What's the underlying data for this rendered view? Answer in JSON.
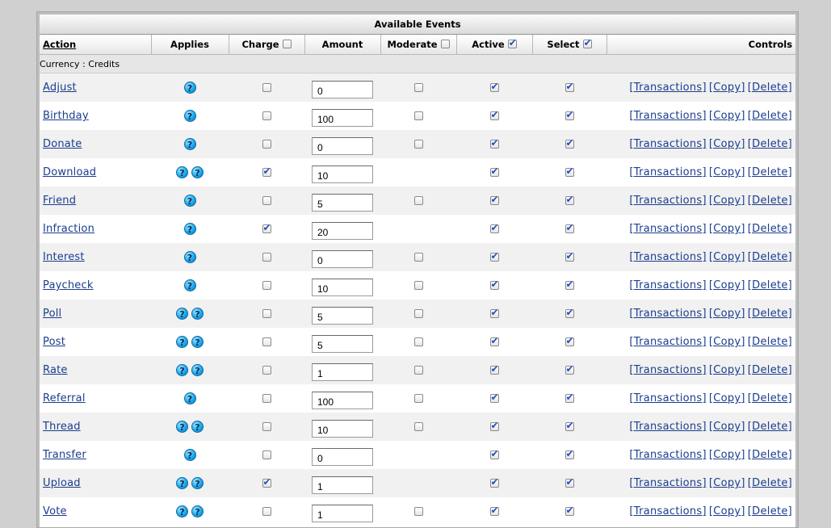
{
  "table": {
    "title": "Available Events",
    "headers": {
      "action": "Action",
      "applies": "Applies",
      "charge": "Charge",
      "amount": "Amount",
      "moderate": "Moderate",
      "active": "Active",
      "select": "Select",
      "controls": "Controls"
    },
    "header_checks": {
      "charge": false,
      "moderate": false,
      "active": true,
      "select": true
    },
    "currency_label": "Currency : Credits",
    "controls_labels": {
      "transactions": "[Transactions]",
      "copy": "[Copy]",
      "delete": "[Delete]"
    },
    "help_icon_glyph": "?",
    "rows": [
      {
        "name": "Adjust",
        "help": 1,
        "charge": false,
        "amount": "0",
        "moderate": false,
        "active": true,
        "select": true
      },
      {
        "name": "Birthday",
        "help": 1,
        "charge": false,
        "amount": "100",
        "moderate": false,
        "active": true,
        "select": true
      },
      {
        "name": "Donate",
        "help": 1,
        "charge": false,
        "amount": "0",
        "moderate": false,
        "active": true,
        "select": true
      },
      {
        "name": "Download",
        "help": 2,
        "charge": true,
        "amount": "10",
        "moderate": null,
        "active": true,
        "select": true
      },
      {
        "name": "Friend",
        "help": 1,
        "charge": false,
        "amount": "5",
        "moderate": false,
        "active": true,
        "select": true
      },
      {
        "name": "Infraction",
        "help": 1,
        "charge": true,
        "amount": "20",
        "moderate": null,
        "active": true,
        "select": true
      },
      {
        "name": "Interest",
        "help": 1,
        "charge": false,
        "amount": "0",
        "moderate": false,
        "active": true,
        "select": true
      },
      {
        "name": "Paycheck",
        "help": 1,
        "charge": false,
        "amount": "10",
        "moderate": false,
        "active": true,
        "select": true
      },
      {
        "name": "Poll",
        "help": 2,
        "charge": false,
        "amount": "5",
        "moderate": false,
        "active": true,
        "select": true
      },
      {
        "name": "Post",
        "help": 2,
        "charge": false,
        "amount": "5",
        "moderate": false,
        "active": true,
        "select": true
      },
      {
        "name": "Rate",
        "help": 2,
        "charge": false,
        "amount": "1",
        "moderate": false,
        "active": true,
        "select": true
      },
      {
        "name": "Referral",
        "help": 1,
        "charge": false,
        "amount": "100",
        "moderate": false,
        "active": true,
        "select": true
      },
      {
        "name": "Thread",
        "help": 2,
        "charge": false,
        "amount": "10",
        "moderate": false,
        "active": true,
        "select": true
      },
      {
        "name": "Transfer",
        "help": 1,
        "charge": false,
        "amount": "0",
        "moderate": null,
        "active": true,
        "select": true
      },
      {
        "name": "Upload",
        "help": 2,
        "charge": true,
        "amount": "1",
        "moderate": null,
        "active": true,
        "select": true
      },
      {
        "name": "Vote",
        "help": 2,
        "charge": false,
        "amount": "1",
        "moderate": false,
        "active": true,
        "select": true
      }
    ]
  },
  "colors": {
    "link": "#1a3d8e",
    "check": "#1f4fbf",
    "help_icon": "#1da6e8"
  }
}
